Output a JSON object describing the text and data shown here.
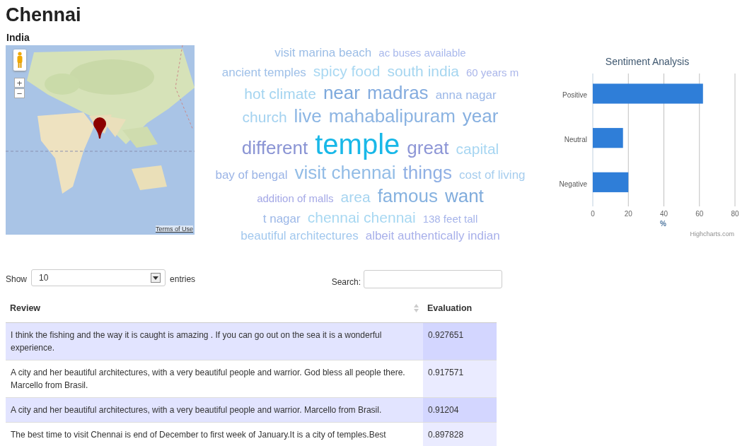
{
  "title": "Chennai",
  "subtitle": "India",
  "map": {
    "kind": "picture",
    "terms": "Terms of Use",
    "zoom_in": "+",
    "zoom_out": "−"
  },
  "word_cloud": [
    [
      {
        "text": "visit marina beach",
        "kind": "small",
        "color": "#9bbde6"
      },
      {
        "text": "ac buses available",
        "kind": "tiny",
        "color": "#a8b8ec"
      }
    ],
    [
      {
        "text": "ancient temples",
        "kind": "small",
        "color": "#9fc0e8"
      },
      {
        "text": "spicy food",
        "kind": "medium",
        "color": "#a9d8f2"
      },
      {
        "text": "south india",
        "kind": "medium",
        "color": "#a6d6f0"
      },
      {
        "text": "60 years m",
        "kind": "tiny",
        "color": "#aab6ea"
      }
    ],
    [
      {
        "text": "hot climate",
        "kind": "medium",
        "color": "#a4d4f0"
      },
      {
        "text": "near",
        "kind": "large",
        "color": "#7da9dc"
      },
      {
        "text": "madras",
        "kind": "large",
        "color": "#84acdf"
      },
      {
        "text": "anna nagar",
        "kind": "small",
        "color": "#9cb8e8"
      }
    ],
    [
      {
        "text": "church",
        "kind": "medium",
        "color": "#a4d2f0"
      },
      {
        "text": "live",
        "kind": "large",
        "color": "#8cb6e4"
      },
      {
        "text": "mahabalipuram",
        "kind": "large",
        "color": "#8cb4e2"
      },
      {
        "text": "year",
        "kind": "large",
        "color": "#87b0e0"
      }
    ],
    [
      {
        "text": "different",
        "kind": "large",
        "color": "#8a94d4"
      },
      {
        "text": "temple",
        "kind": "huge",
        "color": "#19b8e8"
      },
      {
        "text": "great",
        "kind": "large",
        "color": "#8d96d6"
      },
      {
        "text": "capital",
        "kind": "medium",
        "color": "#a7d6f2"
      }
    ],
    [
      {
        "text": "bay of bengal",
        "kind": "small",
        "color": "#9bb4e6"
      },
      {
        "text": "visit chennai",
        "kind": "large",
        "color": "#92bce6"
      },
      {
        "text": "things",
        "kind": "large",
        "color": "#90b0e4"
      },
      {
        "text": "cost of living",
        "kind": "small",
        "color": "#a6cdee"
      }
    ],
    [
      {
        "text": "addition of malls",
        "kind": "tiny",
        "color": "#a4a8e6"
      },
      {
        "text": "area",
        "kind": "medium",
        "color": "#a6d4f0"
      },
      {
        "text": "famous",
        "kind": "large",
        "color": "#86b2e0"
      },
      {
        "text": "want",
        "kind": "large",
        "color": "#80acdc"
      }
    ],
    [
      {
        "text": "t nagar",
        "kind": "small",
        "color": "#9cb8e8"
      },
      {
        "text": "chennai chennai",
        "kind": "medium",
        "color": "#a8d8f2"
      },
      {
        "text": "138 feet tall",
        "kind": "tiny",
        "color": "#a6b4ea"
      }
    ],
    [
      {
        "text": "beautiful architectures",
        "kind": "small",
        "color": "#a2c8ee"
      },
      {
        "text": "albeit authentically indian",
        "kind": "small",
        "color": "#a8b0ea"
      }
    ]
  ],
  "chart": {
    "chart_data": {
      "type": "bar",
      "orientation": "horizontal",
      "title": "Sentiment Analysis",
      "xlabel": "%",
      "categories": [
        "Positive",
        "Neutral",
        "Negative"
      ],
      "series": [
        {
          "color": "#2f7ed8",
          "values": [
            62,
            17,
            20
          ]
        }
      ],
      "grid": true,
      "xlim": [
        0,
        80
      ],
      "xticks": [
        0,
        20,
        40,
        60,
        80
      ]
    },
    "credit": "Highcharts.com"
  },
  "length_control": {
    "label_before": "Show",
    "value": "10",
    "label_after": "entries"
  },
  "search": {
    "label": "Search:"
  },
  "table": {
    "columns": [
      "Review",
      "Evaluation"
    ],
    "rows": [
      [
        "I think the fishing and the way it is caught is amazing . If you can go out on the sea it is a wonderful experience.",
        "0.927651"
      ],
      [
        "A city and her beautiful architectures, with a very beautiful people and warrior. God bless all people there. Marcello from Brasil.",
        "0.917571"
      ],
      [
        "A city and her beautiful architectures, with a very beautiful people and warrior. Marcello from Brasil.",
        "0.91204"
      ],
      [
        "The best time to visit Chennai is end of December to first week of January.It is a city of temples.Best",
        "0.897828"
      ]
    ]
  }
}
